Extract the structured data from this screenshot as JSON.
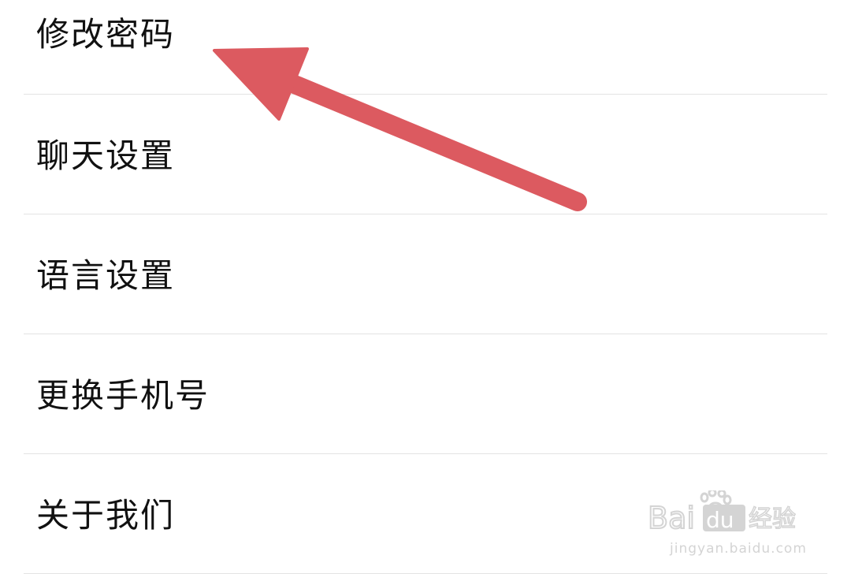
{
  "settings": {
    "items": [
      {
        "label": "修改密码"
      },
      {
        "label": "聊天设置"
      },
      {
        "label": "语言设置"
      },
      {
        "label": "更换手机号"
      },
      {
        "label": "关于我们"
      }
    ]
  },
  "annotation": {
    "icon": "arrow-icon",
    "color": "#dc5a60"
  },
  "watermark": {
    "logo_text": "Baidu经验",
    "url": "jingyan.baidu.com"
  }
}
